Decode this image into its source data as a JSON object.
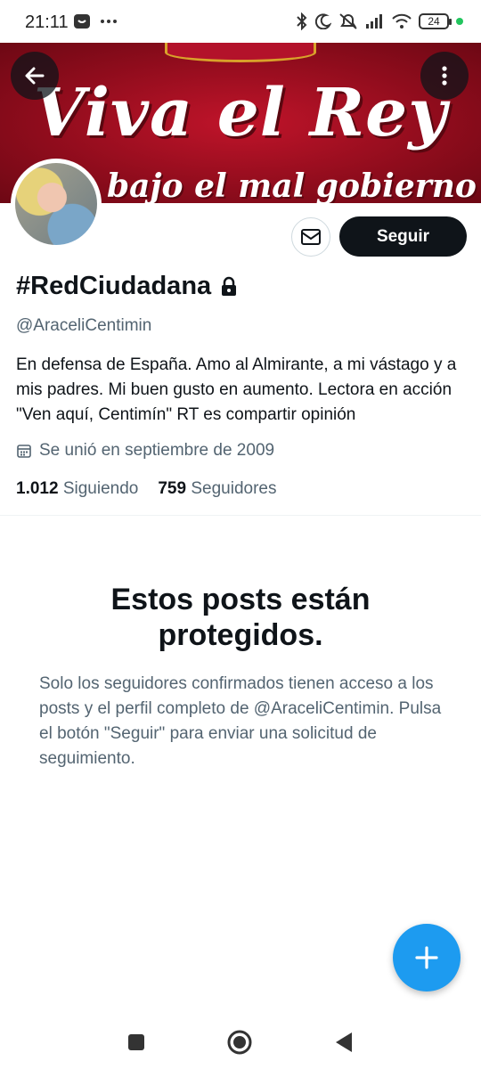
{
  "status_bar": {
    "time": "21:11",
    "battery": "24"
  },
  "banner": {
    "title": "Viva el Rey",
    "subtitle": "bajo el mal gobierno"
  },
  "actions": {
    "follow_label": "Seguir"
  },
  "profile": {
    "display_name": "#RedCiudadana",
    "handle": "@AraceliCentimin",
    "bio": "En defensa de España. Amo al Almirante, a mi vástago y a mis padres. Mi buen gusto en aumento. Lectora en acción \"Ven aquí, Centimín\" RT es compartir opinión",
    "joined": "Se unió en septiembre de 2009",
    "following_count": "1.012",
    "following_label": "Siguiendo",
    "followers_count": "759",
    "followers_label": "Seguidores"
  },
  "protected": {
    "title": "Estos posts están protegidos.",
    "description": "Solo los seguidores confirmados tienen acceso a los posts y el perfil completo de @AraceliCentimin. Pulsa el botón \"Seguir\" para enviar una solicitud de seguimiento."
  },
  "icons": {
    "back": "arrow-left-icon",
    "more": "more-vertical-icon",
    "mail": "mail-icon",
    "lock": "lock-icon",
    "calendar": "calendar-icon",
    "compose": "plus-icon"
  },
  "colors": {
    "accent": "#1d9bf0",
    "follow_button": "#0f1419",
    "secondary_text": "#536471",
    "banner_red": "#a50f22"
  }
}
